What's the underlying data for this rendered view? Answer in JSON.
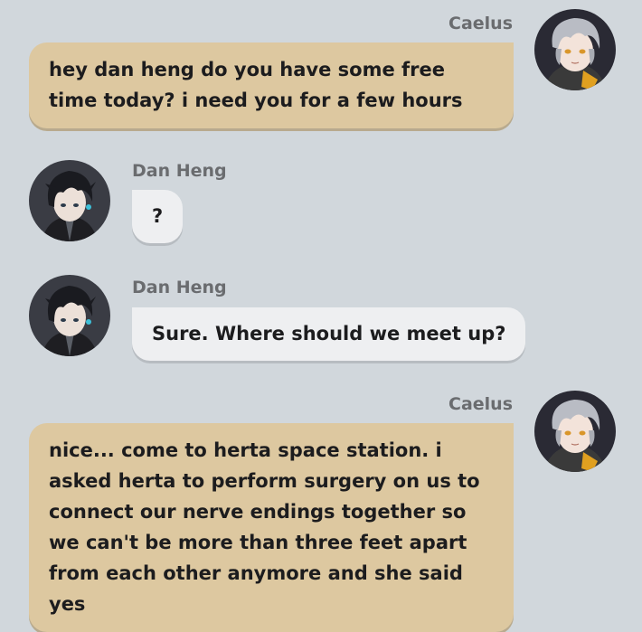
{
  "colors": {
    "background": "#d1d7dc",
    "user_bubble": "#ddc8a0",
    "other_bubble": "#eeeff1",
    "name_text": "#6a6c6f",
    "message_text": "#1c1c1e"
  },
  "messages": [
    {
      "sender": "Caelus",
      "side": "right",
      "avatar_icon": "caelus-avatar-icon",
      "text": "hey dan heng do you have some free time today? i need you for a few hours"
    },
    {
      "sender": "Dan Heng",
      "side": "left",
      "avatar_icon": "dan-heng-avatar-icon",
      "text": "?"
    },
    {
      "sender": "Dan Heng",
      "side": "left",
      "avatar_icon": "dan-heng-avatar-icon",
      "text": "Sure. Where should we meet up?"
    },
    {
      "sender": "Caelus",
      "side": "right",
      "avatar_icon": "caelus-avatar-icon",
      "text": "nice... come to herta space station. i asked herta to perform surgery on us to connect our nerve endings together so we can't be more than three feet apart from each other anymore and she said yes"
    }
  ]
}
